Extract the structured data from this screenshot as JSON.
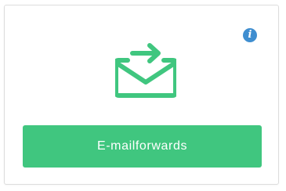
{
  "card": {
    "info_icon_glyph": "i",
    "info_icon_name": "info-icon",
    "mail_icon_name": "mail-forward-icon",
    "button_label": "E-mailforwards"
  },
  "colors": {
    "accent_green": "#40c67f",
    "info_blue": "#3f8ed0",
    "card_border": "#dddddd"
  }
}
